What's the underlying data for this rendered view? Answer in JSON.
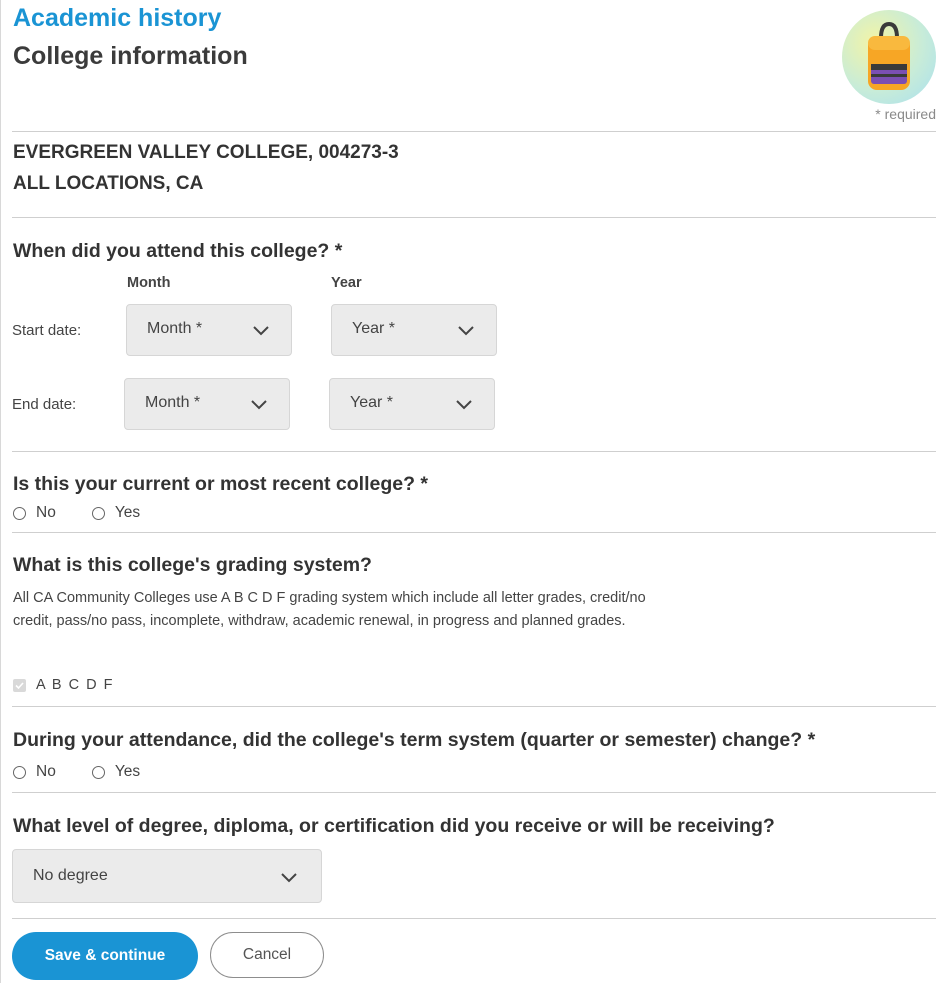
{
  "header": {
    "section_title": "Academic history",
    "page_title": "College information",
    "required_note": "* required",
    "badge_icon": "backpack-icon"
  },
  "college": {
    "name": "EVERGREEN VALLEY COLLEGE, 004273-3",
    "location": "ALL LOCATIONS, CA"
  },
  "attendance": {
    "question": "When did you attend this college? *",
    "month_header": "Month",
    "year_header": "Year",
    "start_label": "Start date:",
    "end_label": "End date:",
    "start_month": "Month *",
    "start_year": "Year *",
    "end_month": "Month *",
    "end_year": "Year *"
  },
  "current_college": {
    "question": "Is this your current or most recent college? *",
    "options": [
      "No",
      "Yes"
    ]
  },
  "grading": {
    "question": "What is this college's grading system?",
    "description": "All CA Community Colleges use A B C D F grading system which include all letter grades, credit/no credit, pass/no pass, incomplete, withdraw, academic renewal, in progress and planned grades.",
    "checkbox_label": "A B C D F",
    "checkbox_checked": true
  },
  "term_change": {
    "question": "During your attendance, did the college's term system (quarter or semester) change? *",
    "options": [
      "No",
      "Yes"
    ]
  },
  "degree": {
    "question": "What level of degree, diploma, or certification did you receive or will be receiving?",
    "selected": "No degree"
  },
  "actions": {
    "save_label": "Save & continue",
    "cancel_label": "Cancel"
  },
  "colors": {
    "accent": "#1a94d4",
    "field_bg": "#ebebeb",
    "divider": "#cfcfcf"
  }
}
